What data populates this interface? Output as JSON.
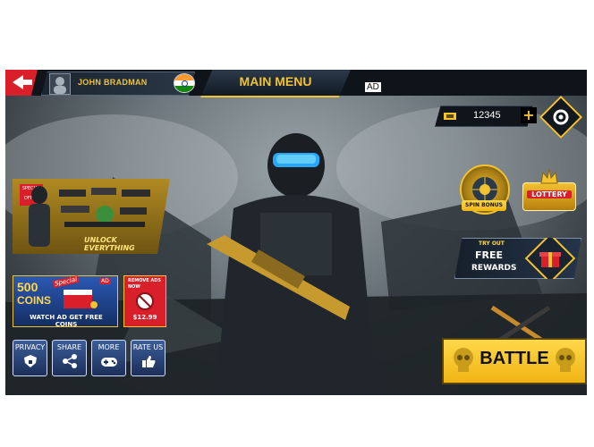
{
  "top_bar": {
    "player_name": "JOHN BRADMAN",
    "menu_title": "MAIN MENU",
    "ad_label": "AD"
  },
  "currency": {
    "coins": "12345",
    "add_label": "+"
  },
  "left_panel": {
    "special_offer": "SPECIAL OFFER",
    "unlock_label": "UNLOCK EVERYTHING"
  },
  "coins_offer": {
    "amount": "500",
    "unit": "COINS",
    "tag": "Special",
    "ad_tag": "AD",
    "watch_label": "WATCH AD GET FREE COINS"
  },
  "remove_ads": {
    "title": "REMOVE ADS NOW",
    "price": "$12.99"
  },
  "small_buttons": [
    {
      "label": "PRIVACY",
      "icon": "shield-lock-icon"
    },
    {
      "label": "SHARE",
      "icon": "share-icon"
    },
    {
      "label": "MORE",
      "icon": "gamepad-icon"
    },
    {
      "label": "RATE US",
      "icon": "thumbs-up-icon"
    }
  ],
  "right_panel": {
    "spin_label": "SPIN BONUS",
    "lottery_label": "LOTTERY",
    "try_label": "TRY OUT",
    "free_label": "FREE",
    "rewards_label": "REWARDS",
    "battle_label": "BATTLE"
  },
  "colors": {
    "accent_gold": "#f2c230",
    "back_red": "#d9202a",
    "ad_red": "#d9202a"
  }
}
